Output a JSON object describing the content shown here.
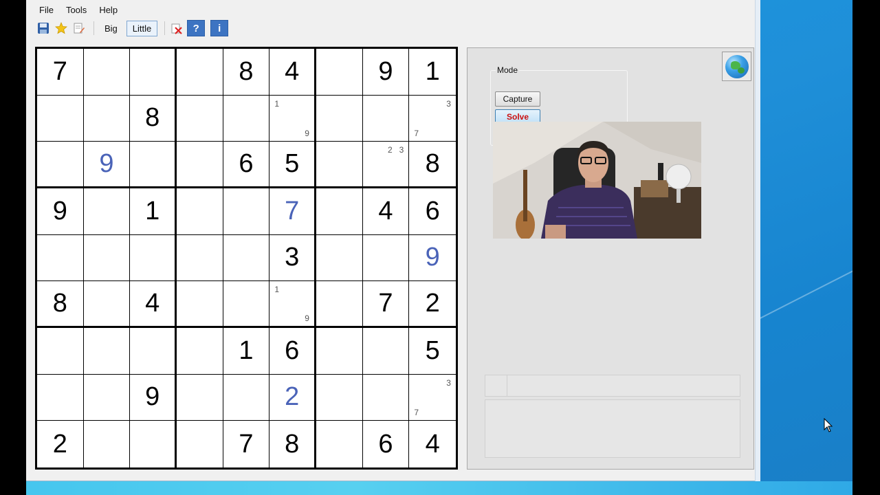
{
  "menu": {
    "file": "File",
    "tools": "Tools",
    "help": "Help"
  },
  "toolbar": {
    "save_icon": "save-icon",
    "star_icon": "star-icon",
    "edit_icon": "edit-icon",
    "big_label": "Big",
    "little_label": "Little",
    "clear_icon": "clear-icon",
    "help_label": "?",
    "info_label": "i"
  },
  "board": {
    "rows": [
      [
        {
          "v": "7",
          "t": "given"
        },
        {
          "v": ""
        },
        {
          "v": ""
        },
        {
          "v": ""
        },
        {
          "v": "8",
          "t": "given"
        },
        {
          "v": "4",
          "t": "given"
        },
        {
          "v": ""
        },
        {
          "v": "9",
          "t": "given"
        },
        {
          "v": "1",
          "t": "given"
        }
      ],
      [
        {
          "v": ""
        },
        {
          "v": ""
        },
        {
          "v": "8",
          "t": "given"
        },
        {
          "v": ""
        },
        {
          "v": ""
        },
        {
          "v": "",
          "pm": {
            "tl": "1",
            "br": "9"
          }
        },
        {
          "v": ""
        },
        {
          "v": ""
        },
        {
          "v": "",
          "pm": {
            "tr": "3",
            "bl": "7"
          }
        }
      ],
      [
        {
          "v": ""
        },
        {
          "v": "9",
          "t": "solved"
        },
        {
          "v": ""
        },
        {
          "v": ""
        },
        {
          "v": "6",
          "t": "given"
        },
        {
          "v": "5",
          "t": "given"
        },
        {
          "v": ""
        },
        {
          "v": "",
          "pm": {
            "tr": "2   3"
          }
        },
        {
          "v": "8",
          "t": "given"
        }
      ],
      [
        {
          "v": "9",
          "t": "given"
        },
        {
          "v": ""
        },
        {
          "v": "1",
          "t": "given"
        },
        {
          "v": ""
        },
        {
          "v": ""
        },
        {
          "v": "7",
          "t": "solved"
        },
        {
          "v": ""
        },
        {
          "v": "4",
          "t": "given"
        },
        {
          "v": "6",
          "t": "given"
        }
      ],
      [
        {
          "v": ""
        },
        {
          "v": ""
        },
        {
          "v": ""
        },
        {
          "v": ""
        },
        {
          "v": ""
        },
        {
          "v": "3",
          "t": "given"
        },
        {
          "v": ""
        },
        {
          "v": ""
        },
        {
          "v": "9",
          "t": "solved"
        }
      ],
      [
        {
          "v": "8",
          "t": "given"
        },
        {
          "v": ""
        },
        {
          "v": "4",
          "t": "given"
        },
        {
          "v": ""
        },
        {
          "v": ""
        },
        {
          "v": "",
          "pm": {
            "tl": "1",
            "br": "9"
          }
        },
        {
          "v": ""
        },
        {
          "v": "7",
          "t": "given"
        },
        {
          "v": "2",
          "t": "given"
        }
      ],
      [
        {
          "v": ""
        },
        {
          "v": ""
        },
        {
          "v": ""
        },
        {
          "v": ""
        },
        {
          "v": "1",
          "t": "given"
        },
        {
          "v": "6",
          "t": "given"
        },
        {
          "v": ""
        },
        {
          "v": ""
        },
        {
          "v": "5",
          "t": "given"
        }
      ],
      [
        {
          "v": ""
        },
        {
          "v": ""
        },
        {
          "v": "9",
          "t": "given"
        },
        {
          "v": ""
        },
        {
          "v": ""
        },
        {
          "v": "2",
          "t": "solved"
        },
        {
          "v": ""
        },
        {
          "v": ""
        },
        {
          "v": "",
          "pm": {
            "tr": "3",
            "bl": "7"
          }
        }
      ],
      [
        {
          "v": "2",
          "t": "given"
        },
        {
          "v": ""
        },
        {
          "v": ""
        },
        {
          "v": ""
        },
        {
          "v": "7",
          "t": "given"
        },
        {
          "v": "8",
          "t": "given"
        },
        {
          "v": ""
        },
        {
          "v": "6",
          "t": "given"
        },
        {
          "v": "4",
          "t": "given"
        }
      ]
    ]
  },
  "panel": {
    "globe_icon": "globe-icon",
    "mode_label": "Mode",
    "capture_label": "Capture",
    "solve_label": "Solve",
    "status_text": "",
    "log_text": ""
  },
  "colors": {
    "solved_digit": "#4a63b8",
    "solve_text": "#cc1010",
    "desktop": "#1f8fd8"
  }
}
